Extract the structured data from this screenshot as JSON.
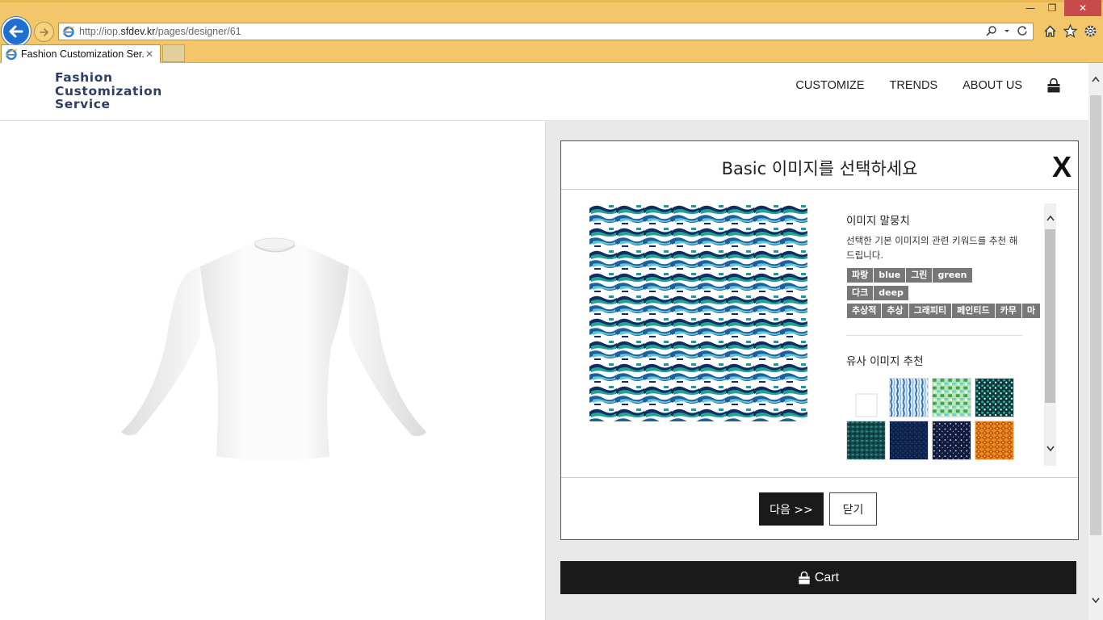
{
  "browser": {
    "url_prefix": "http://iop.",
    "url_domain": "sfdev.kr",
    "url_path": "/pages/designer/61",
    "tab_title": "Fashion Customization Ser...",
    "tab_close": "✕",
    "win_min": "—",
    "win_max": "❐",
    "win_close": "✕"
  },
  "site": {
    "logo_lines": [
      "Fashion",
      "Customization",
      "Service"
    ],
    "nav": [
      "CUSTOMIZE",
      "TRENDS",
      "ABOUT US"
    ]
  },
  "modal": {
    "title": "Basic 이미지를 선택하세요",
    "close": "X",
    "keywords_title": "이미지 말뭉치",
    "keywords_desc": "선택한 기본 이미지의 관련 키워드를 추천 해드립니다.",
    "tags": [
      "파랑",
      "blue",
      "그린",
      "green",
      "다크",
      "deep",
      "추상적",
      "추상",
      "그래피티",
      "페인티드",
      "카무",
      "마"
    ],
    "similar_title": "유사 이미지 추천",
    "next_label": "다음 >>",
    "close_label": "닫기"
  },
  "cart_label": "Cart",
  "colors": {
    "accent_dark": "#1a1a1a",
    "tag_bg": "#777777",
    "logo": "#2c3e63",
    "chrome": "#f3c669"
  },
  "icons": [
    "back-arrow-icon",
    "forward-arrow-icon",
    "ie-icon",
    "search-icon",
    "refresh-icon",
    "home-icon",
    "star-icon",
    "gear-icon",
    "shopping-bag-icon",
    "chevron-up-icon",
    "chevron-down-icon"
  ]
}
